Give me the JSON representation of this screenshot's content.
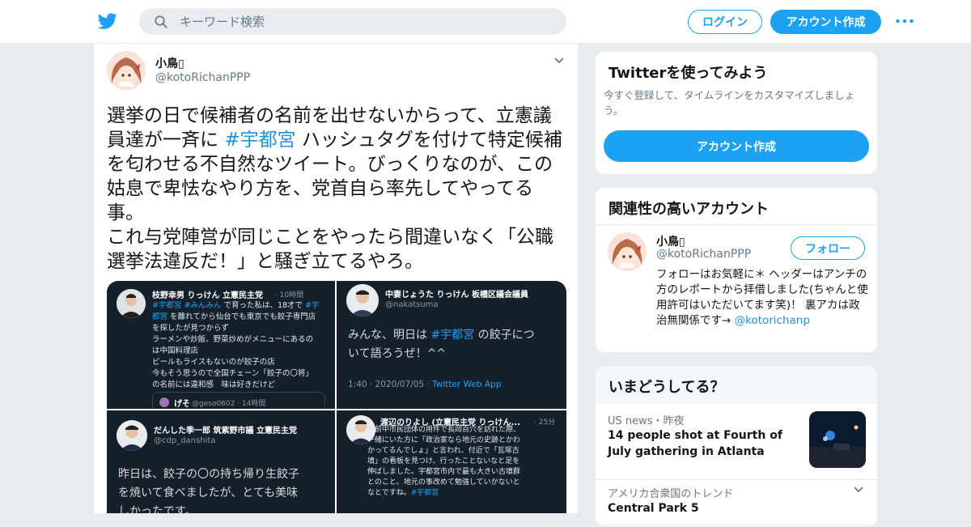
{
  "colors": {
    "accent": "#1da1f2",
    "link": "#1b95e0",
    "secondary_text": "#657786",
    "background": "#e6ecf0"
  },
  "header": {
    "logo_icon": "twitter-bird-icon",
    "search": {
      "placeholder": "キーワード検索",
      "value": ""
    },
    "login_label": "ログイン",
    "signup_label": "アカウント作成",
    "more_icon": "more-dots-icon"
  },
  "tweet": {
    "author_name": "小鳥▯",
    "author_handle": "@kotoRichanPPP",
    "text_1": "選挙の日で候補者の名前を出せないからって、立憲議員達が一斉に ",
    "hashtag": "#宇都宮",
    "text_2": " ハッシュタグを付けて特定候補を匂わせる不自然なツイート。びっくりなのが、この姑息で卑怯なやり方を、党首自ら率先してやってる事。\nこれ与党陣営が同じことをやったら間違いなく「公職選挙法違反だ！」と騒ぎ立てるやろ。",
    "media": [
      {
        "name": "枝野幸男 りっけん 立憲民主党",
        "time": "· 10時間",
        "body_a": "#宇都宮 #みんみん",
        "body_b": " で育った私は、18才で ",
        "body_c": "#宇\n都宮",
        "body_d": " を離れてから仙台でも東京でも餃子専門店\nを探したが見つからず\nラーメンや炒飯、野菜炒めがメニューにあるの\nは中国料理店\nビールもライスもないのが餃子の店\n今もそう思うので全国チェーン「餃子の〇将」\nの名前には違和感　味は好きだけど",
        "reply_name": "げそ",
        "reply_handle": "@geso0602 · 14時間"
      },
      {
        "name": "中妻じょうた りっけん 板橋区議会議員",
        "handle": "@nakatsuma",
        "body_a": "みんな、明日は ",
        "body_b": "#宇都宮",
        "body_c": " の餃子につ\nいて語ろうぜ！^^",
        "meta_a": "1:40 · 2020/07/05 · ",
        "meta_b": "Twitter Web App"
      },
      {
        "name": "だんした季一郎 筑紫野市議 立憲民主党",
        "handle": "@cdp_danshita",
        "body": "昨日は、餃子の〇の持ち帰り生餃子\nを焼いて食べましたが、とても美味\nしかったです。"
      },
      {
        "name": "渡辺のりよし (立憲民主党 りっけん...",
        "time": "· 25分",
        "body": "午前中市民団体の用件で長岡百穴を訪れた際、\n一緒にいた方に「政治家なら地元の史跡とかわ\nかってるんでしょ」と言われ、付近で「瓦塚古\n墳」の看板を見つけ、行ったことないなと足を\n伸ばしました。宇都宮市内で最も大きい古墳群\nとのこと。地元の事改めて勉強していかないと\nなとですね。",
        "tag": "#宇都宮"
      }
    ]
  },
  "sidebar": {
    "try_twitter": {
      "title": "Twitterを使ってみよう",
      "description": "今すぐ登録して、タイムラインをカスタマイズしましょう。",
      "cta_label": "アカウント作成"
    },
    "related": {
      "title": "関連性の高いアカウント",
      "name": "小鳥▯",
      "handle": "@kotoRichanPPP",
      "follow_label": "フォロー",
      "bio": "フォローはお気軽に＊ ヘッダーはアンチの方のレポートから拝借しました(ちゃんと使用許可はいただいてます笑)！ 裏アカは政治無関係です→ ",
      "bio_link": "@kotorichanp"
    },
    "happening": {
      "title": "いまどうしてる？",
      "news_meta": "US news・昨夜",
      "news_headline": "14 people shot at Fourth of July gathering in Atlanta",
      "trend_meta": "アメリカ合衆国のトレンド",
      "trend_title": "Central Park 5"
    }
  }
}
